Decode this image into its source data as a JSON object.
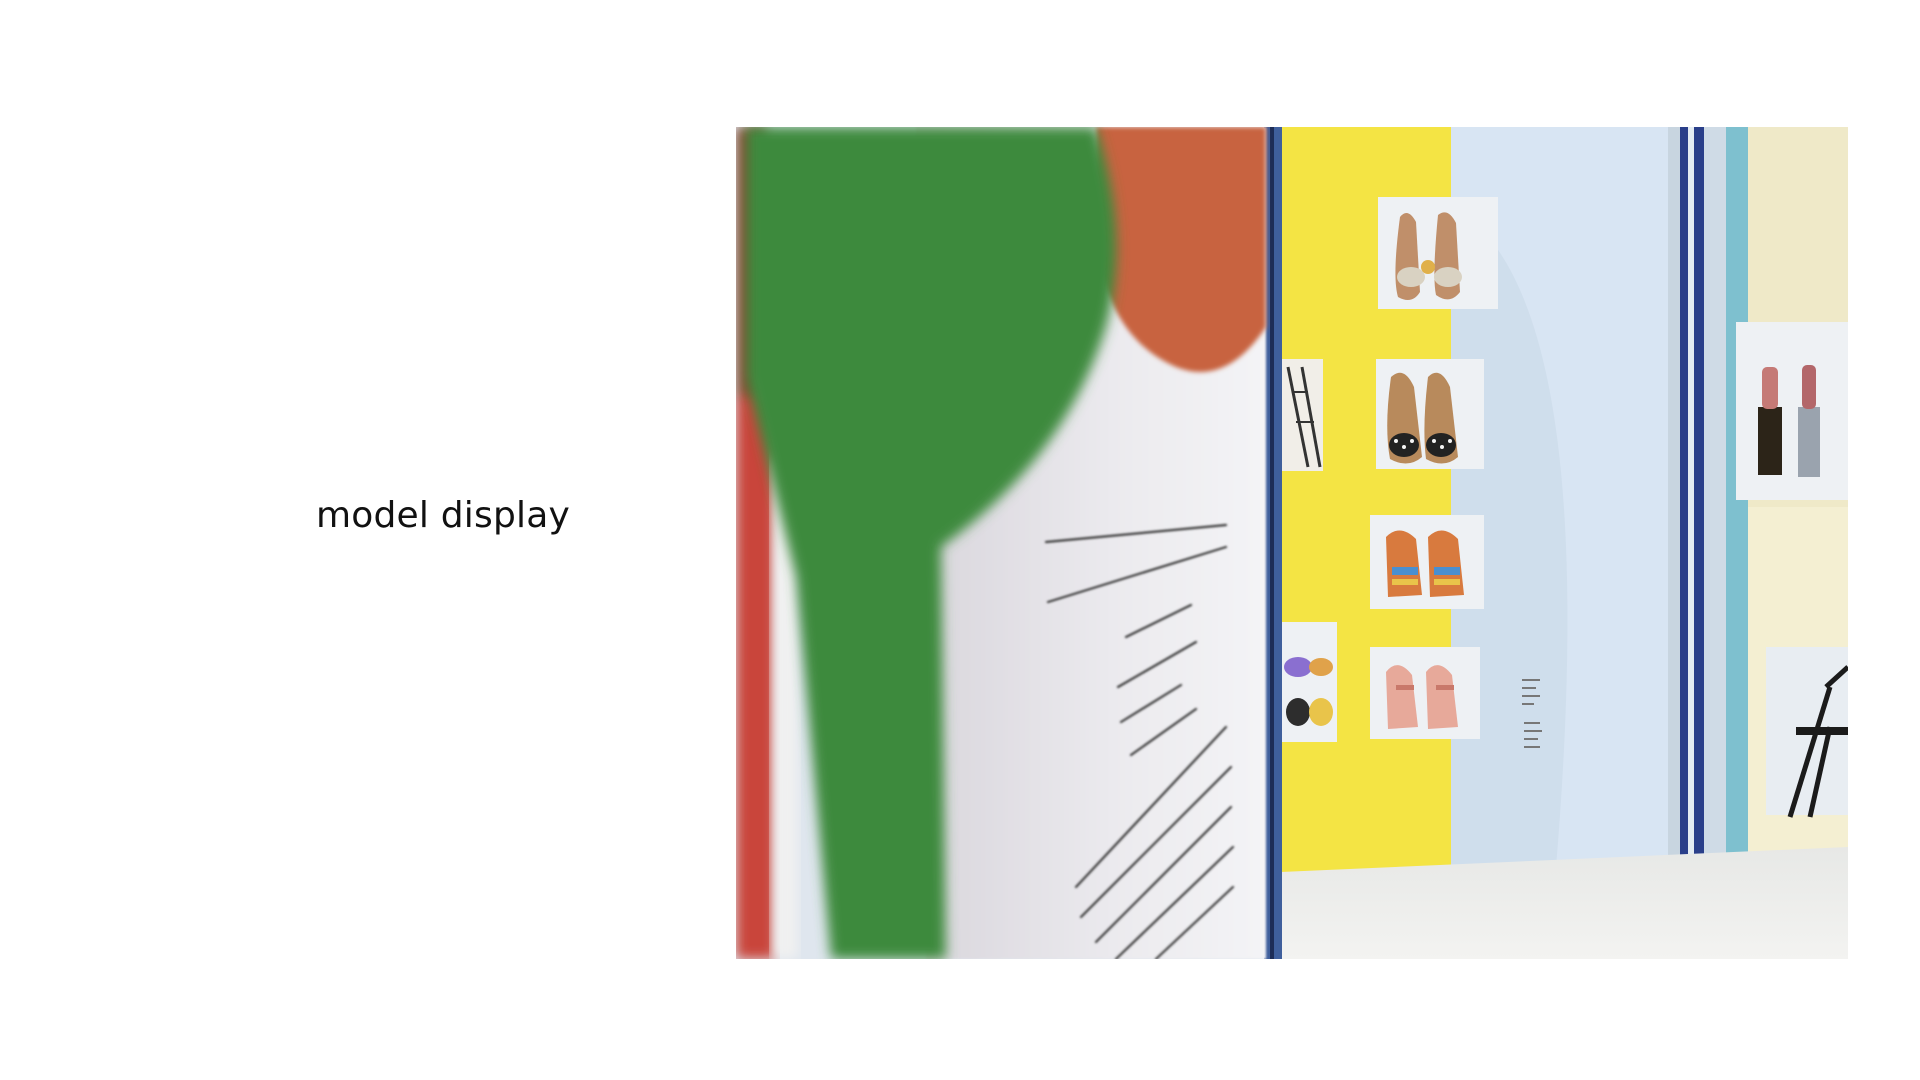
{
  "caption": {
    "text": "model display"
  },
  "photo": {
    "description_icon": "photo-of-folded-paper-model-display",
    "colors": {
      "green": "#3c8a3c",
      "red": "#c9443a",
      "terracotta": "#c8643f",
      "yellow": "#f4e444",
      "light_blue": "#d6e4f2",
      "navy": "#2a3f8a",
      "teal": "#6fb7c8",
      "cream": "#efe9c8",
      "floor": "#eeeeea"
    }
  }
}
